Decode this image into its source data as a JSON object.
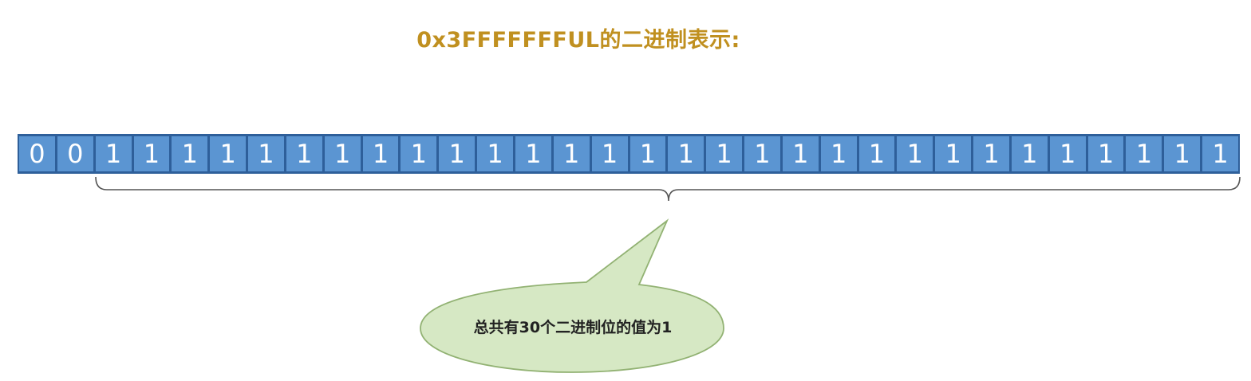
{
  "title": "0x3FFFFFFFUL的二进制表示:",
  "bits": [
    "0",
    "0",
    "1",
    "1",
    "1",
    "1",
    "1",
    "1",
    "1",
    "1",
    "1",
    "1",
    "1",
    "1",
    "1",
    "1",
    "1",
    "1",
    "1",
    "1",
    "1",
    "1",
    "1",
    "1",
    "1",
    "1",
    "1",
    "1",
    "1",
    "1",
    "1",
    "1"
  ],
  "callout": "总共有30个二进制位的值为1",
  "colors": {
    "title": "#c09020",
    "cell_fill": "#5b95d2",
    "cell_border": "#2e5f9a",
    "callout_fill": "#d6e8c4",
    "callout_border": "#92b273"
  }
}
